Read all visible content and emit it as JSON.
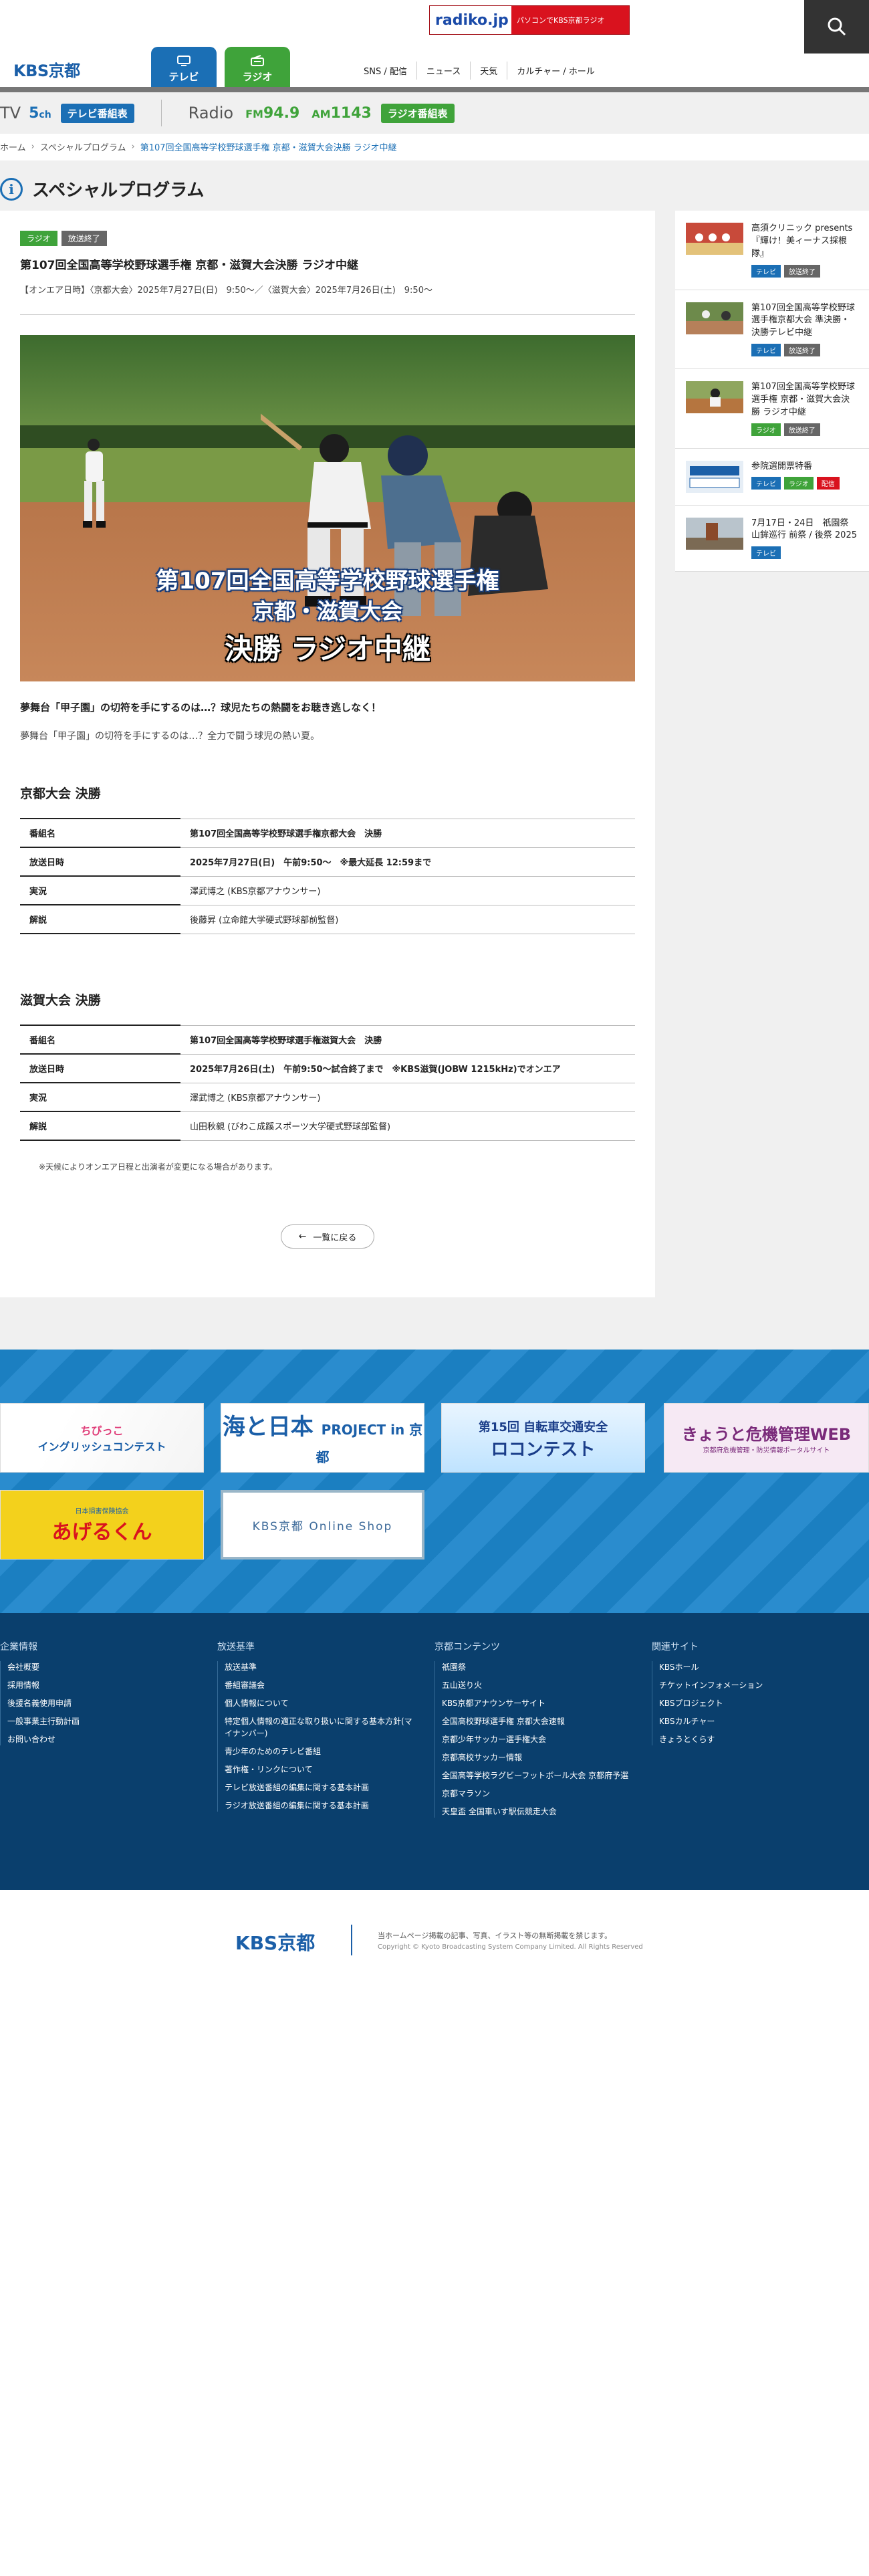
{
  "header": {
    "radiko_logo": "radiko.jp",
    "radiko_text": "パソコンでKBS京都ラジオ",
    "logo": "KBS京都",
    "tab_tv": "テレビ",
    "tab_radio": "ラジオ",
    "nav": [
      "SNS / 配信",
      "ニュース",
      "天気",
      "カルチャー / ホール"
    ]
  },
  "channels": {
    "tv_label": "TV",
    "tv_num": "5",
    "tv_unit": "ch",
    "tv_button": "テレビ番組表",
    "radio_label": "Radio",
    "fm_label": "FM",
    "fm_freq": "94.9",
    "am_label": "AM",
    "am_freq": "1143",
    "radio_button": "ラジオ番組表"
  },
  "breadcrumb": {
    "home": "ホーム",
    "special": "スペシャルプログラム",
    "current": "第107回全国高等学校野球選手権 京都・滋賀大会決勝 ラジオ中継"
  },
  "page_title": "スペシャルプログラム",
  "article": {
    "tags": [
      "ラジオ",
      "放送終了"
    ],
    "title": "第107回全国高等学校野球選手権 京都・滋賀大会決勝 ラジオ中継",
    "onair": "【オンエア日時】〈京都大会〉2025年7月27日(日)　9:50〜／〈滋賀大会〉2025年7月26日(土)　9:50〜",
    "hero_line1": "第107回全国高等学校野球選手権",
    "hero_line2": "京都・滋賀大会",
    "hero_line3": "決勝 ラジオ中継",
    "lead_bold": "夢舞台「甲子園」の切符を手にするのは…？球児たちの熱闘をお聴き逃しなく！",
    "lead": "夢舞台「甲子園」の切符を手にするのは…？全力で闘う球児の熱い夏。",
    "kyoto_heading": "京都大会 決勝",
    "kyoto_rows": [
      {
        "k": "番組名",
        "v": "第107回全国高等学校野球選手権京都大会　決勝",
        "bold": true
      },
      {
        "k": "放送日時",
        "v": "2025年7月27日(日)　午前9:50〜　※最大延長 12:59まで",
        "bold": true
      },
      {
        "k": "実況",
        "v": "澤武博之 (KBS京都アナウンサー)",
        "bold": false
      },
      {
        "k": "解説",
        "v": "後藤昇 (立命館大学硬式野球部前監督)",
        "bold": false
      }
    ],
    "shiga_heading": "滋賀大会 決勝",
    "shiga_rows": [
      {
        "k": "番組名",
        "v": "第107回全国高等学校野球選手権滋賀大会　決勝",
        "bold": true
      },
      {
        "k": "放送日時",
        "v": "2025年7月26日(土)　午前9:50〜試合終了まで　※KBS滋賀(JOBW 1215kHz)でオンエア",
        "bold": true
      },
      {
        "k": "実況",
        "v": "澤武博之 (KBS京都アナウンサー)",
        "bold": false
      },
      {
        "k": "解説",
        "v": "山田秋親 (びわこ成蹊スポーツ大学硬式野球部監督)",
        "bold": false
      }
    ],
    "note": "※天候によりオンエア日程と出演者が変更になる場合があります。",
    "back_label": "一覧に戻る"
  },
  "sidebar": [
    {
      "title": "高須クリニック presents『輝け！美ィーナス採根隊』",
      "tags": [
        {
          "t": "テレビ",
          "c": "blue"
        },
        {
          "t": "放送終了",
          "c": "gray"
        }
      ]
    },
    {
      "title": "第107回全国高等学校野球選手権京都大会 準決勝・決勝テレビ中継",
      "tags": [
        {
          "t": "テレビ",
          "c": "blue"
        },
        {
          "t": "放送終了",
          "c": "gray"
        }
      ]
    },
    {
      "title": "第107回全国高等学校野球選手権 京都・滋賀大会決勝 ラジオ中継",
      "tags": [
        {
          "t": "ラジオ",
          "c": "green"
        },
        {
          "t": "放送終了",
          "c": "gray"
        }
      ]
    },
    {
      "title": "参院選開票特番",
      "tags": [
        {
          "t": "テレビ",
          "c": "blue"
        },
        {
          "t": "ラジオ",
          "c": "green"
        },
        {
          "t": "配信",
          "c": "red"
        }
      ]
    },
    {
      "title": "7月17日・24日　祇園祭 山鉾巡行 前祭 / 後祭 2025",
      "tags": [
        {
          "t": "テレビ",
          "c": "blue"
        }
      ]
    }
  ],
  "banners": {
    "b1_main": "ちびっこ",
    "b1_sub": "イングリッシュコンテスト",
    "b2_main": "海と日本",
    "b2_sub": "PROJECT in 京都",
    "b3_main": "第15回 自転車交通安全",
    "b3_sub": "ロコンテスト",
    "b4_main": "きょうと危機管理WEB",
    "b4_sub": "京都府危機管理・防災情報ポータルサイト",
    "b5_small": "日本損害保険協会",
    "b5_main": "あげるくん",
    "b6_main": "KBS京都 Online Shop"
  },
  "footer_cols": [
    {
      "heading": "企業情報",
      "items": [
        "会社概要",
        "採用情報",
        "後援名義使用申請",
        "一般事業主行動計画",
        "お問い合わせ"
      ]
    },
    {
      "heading": "放送基準",
      "items": [
        "放送基準",
        "番組審議会",
        "個人情報について",
        "特定個人情報の適正な取り扱いに関する基本方針(マイナンバー)",
        "青少年のためのテレビ番組",
        "著作権・リンクについて",
        "テレビ放送番組の編集に関する基本計画",
        "ラジオ放送番組の編集に関する基本計画"
      ]
    },
    {
      "heading": "京都コンテンツ",
      "items": [
        "祇園祭",
        "五山送り火",
        "KBS京都アナウンサーサイト",
        "全国高校野球選手権 京都大会速報",
        "京都少年サッカー選手権大会",
        "京都高校サッカー情報",
        "全国高等学校ラグビーフットボール大会 京都府予選",
        "京都マラソン",
        "天皇盃 全国車いす駅伝競走大会"
      ]
    },
    {
      "heading": "関連サイト",
      "items": [
        "KBSホール",
        "チケットインフォメーション",
        "KBSプロジェクト",
        "KBSカルチャー",
        "きょうとくらす"
      ]
    }
  ],
  "bottom_footer": {
    "logo": "KBS京都",
    "notice": "当ホームページ掲載の記事、写真、イラスト等の無断掲載を禁じます。",
    "copyright": "Copyright © Kyoto Broadcasting System Company Limited. All Rights Reserved"
  }
}
